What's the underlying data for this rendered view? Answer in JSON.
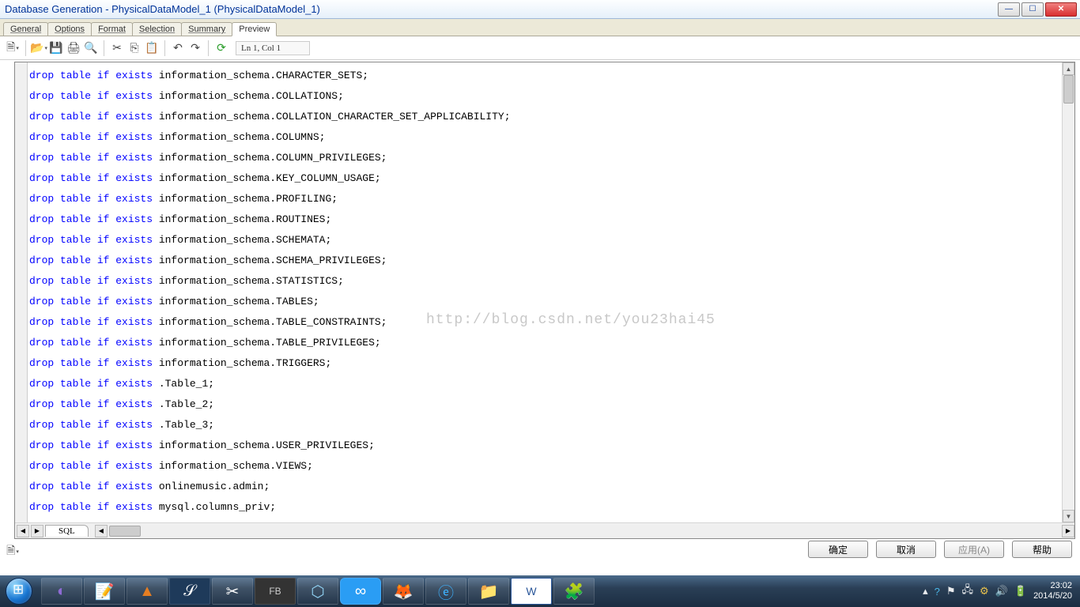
{
  "window": {
    "title": "Database Generation - PhysicalDataModel_1 (PhysicalDataModel_1)"
  },
  "tabs": [
    {
      "label": "General"
    },
    {
      "label": "Options"
    },
    {
      "label": "Format"
    },
    {
      "label": "Selection"
    },
    {
      "label": "Summary"
    },
    {
      "label": "Preview",
      "active": true
    }
  ],
  "toolbar": {
    "cursor_position": "Ln 1, Col 1"
  },
  "bottom_tab": "SQL",
  "watermark": "http://blog.csdn.net/you23hai45",
  "dialog_buttons": {
    "ok": "确定",
    "cancel": "取消",
    "apply": "应用(A)",
    "help": "帮助"
  },
  "sql_lines": [
    {
      "kw": "drop table if exists",
      "rest": " information_schema.CHARACTER_SETS;"
    },
    {
      "kw": "drop table if exists",
      "rest": " information_schema.COLLATIONS;"
    },
    {
      "kw": "drop table if exists",
      "rest": " information_schema.COLLATION_CHARACTER_SET_APPLICABILITY;"
    },
    {
      "kw": "drop table if exists",
      "rest": " information_schema.COLUMNS;"
    },
    {
      "kw": "drop table if exists",
      "rest": " information_schema.COLUMN_PRIVILEGES;"
    },
    {
      "kw": "drop table if exists",
      "rest": " information_schema.KEY_COLUMN_USAGE;"
    },
    {
      "kw": "drop table if exists",
      "rest": " information_schema.PROFILING;"
    },
    {
      "kw": "drop table if exists",
      "rest": " information_schema.ROUTINES;"
    },
    {
      "kw": "drop table if exists",
      "rest": " information_schema.SCHEMATA;"
    },
    {
      "kw": "drop table if exists",
      "rest": " information_schema.SCHEMA_PRIVILEGES;"
    },
    {
      "kw": "drop table if exists",
      "rest": " information_schema.STATISTICS;"
    },
    {
      "kw": "drop table if exists",
      "rest": " information_schema.TABLES;"
    },
    {
      "kw": "drop table if exists",
      "rest": " information_schema.TABLE_CONSTRAINTS;"
    },
    {
      "kw": "drop table if exists",
      "rest": " information_schema.TABLE_PRIVILEGES;"
    },
    {
      "kw": "drop table if exists",
      "rest": " information_schema.TRIGGERS;"
    },
    {
      "kw": "drop table if exists",
      "rest": " .Table_1;"
    },
    {
      "kw": "drop table if exists",
      "rest": " .Table_2;"
    },
    {
      "kw": "drop table if exists",
      "rest": " .Table_3;"
    },
    {
      "kw": "drop table if exists",
      "rest": " information_schema.USER_PRIVILEGES;"
    },
    {
      "kw": "drop table if exists",
      "rest": " information_schema.VIEWS;"
    },
    {
      "kw": "drop table if exists",
      "rest": " onlinemusic.admin;"
    },
    {
      "kw": "drop table if exists",
      "rest": " mysql.columns_priv;"
    }
  ],
  "taskbar": {
    "clock_time": "23:02",
    "clock_date": "2014/5/20"
  }
}
